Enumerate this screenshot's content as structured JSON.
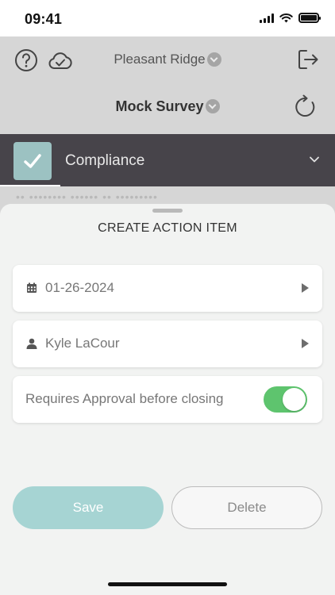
{
  "status_bar": {
    "time": "09:41"
  },
  "header": {
    "location": "Pleasant Ridge",
    "survey": "Mock Survey",
    "icons": [
      "help-icon",
      "cloud-check-icon",
      "logout-icon",
      "refresh-icon",
      "chevron-down-icon"
    ]
  },
  "section": {
    "label": "Compliance",
    "checked": true,
    "hidden_text": "•• •••••••• •••••• •• •••••••••"
  },
  "sheet": {
    "title": "CREATE ACTION ITEM",
    "date": {
      "value": "01-26-2024",
      "icon": "calendar-icon"
    },
    "assignee": {
      "value": "Kyle LaCour",
      "icon": "user-icon"
    },
    "approval": {
      "label": "Requires Approval before closing",
      "enabled": true
    },
    "save_label": "Save",
    "delete_label": "Delete"
  },
  "colors": {
    "section_bar": "#47444a",
    "check_accent": "#9cc2c2",
    "save_button": "#a6d4d3",
    "toggle_on": "#5ec46e"
  }
}
